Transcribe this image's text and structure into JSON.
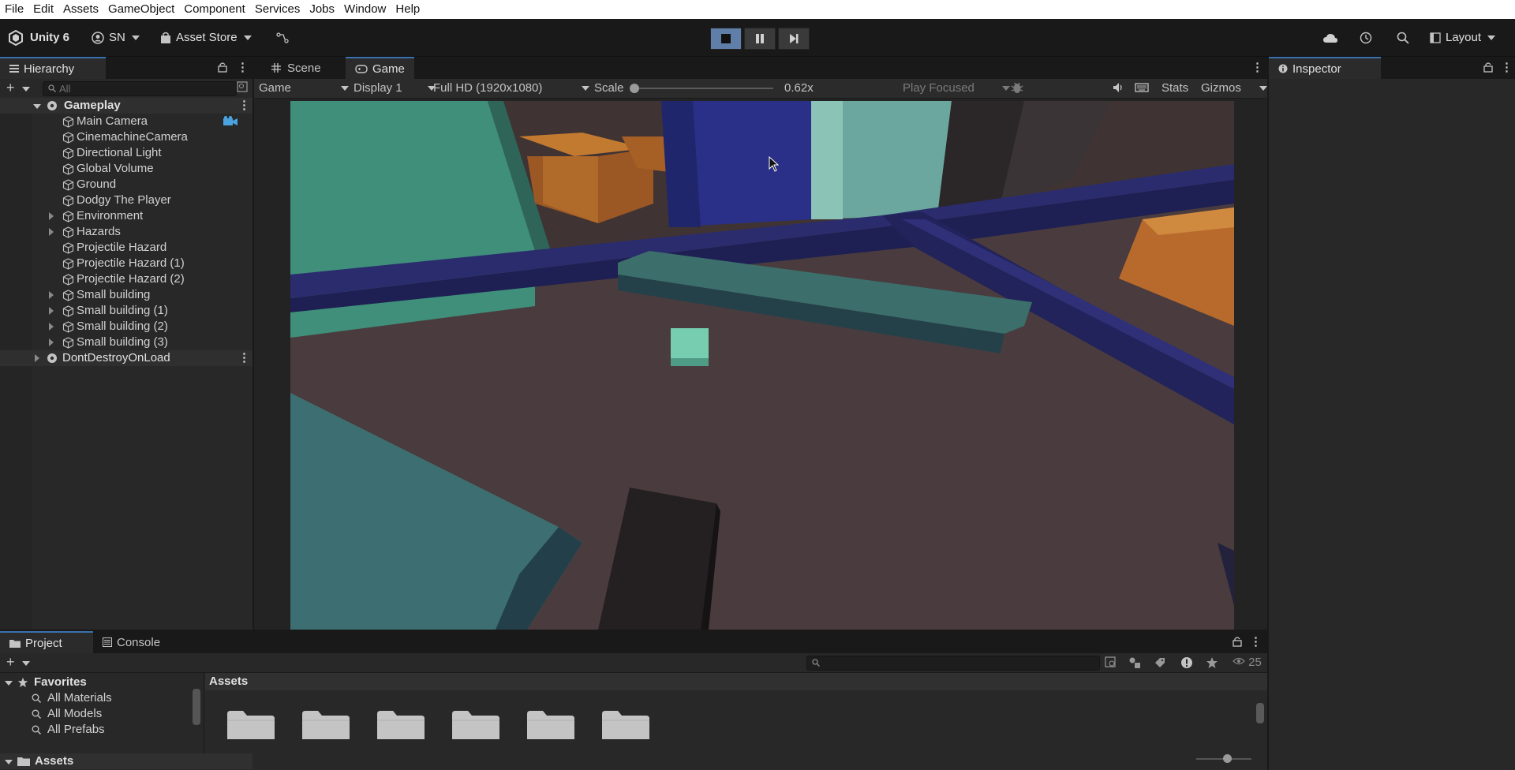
{
  "menu": [
    "File",
    "Edit",
    "Assets",
    "GameObject",
    "Component",
    "Services",
    "Jobs",
    "Window",
    "Help"
  ],
  "toolbar": {
    "app_label": "Unity 6",
    "account_label": "SN",
    "asset_store_label": "Asset Store",
    "layout_label": "Layout"
  },
  "hierarchy": {
    "tab_label": "Hierarchy",
    "search_placeholder": "All",
    "scenes": [
      {
        "name": "Gameplay"
      },
      {
        "name": "DontDestroyOnLoad"
      }
    ],
    "items": [
      {
        "label": "Main Camera"
      },
      {
        "label": "CinemachineCamera"
      },
      {
        "label": "Directional Light"
      },
      {
        "label": "Global Volume"
      },
      {
        "label": "Ground"
      },
      {
        "label": "Dodgy The Player"
      },
      {
        "label": "Environment"
      },
      {
        "label": "Hazards"
      },
      {
        "label": "Projectile Hazard"
      },
      {
        "label": "Projectile Hazard (1)"
      },
      {
        "label": "Projectile Hazard (2)"
      },
      {
        "label": "Small building"
      },
      {
        "label": "Small building (1)"
      },
      {
        "label": "Small building (2)"
      },
      {
        "label": "Small building (3)"
      }
    ]
  },
  "game_view": {
    "tabs": [
      "Scene",
      "Game"
    ],
    "view_select": "Game",
    "display_select": "Display 1",
    "resolution_select": "Full HD (1920x1080)",
    "scale_label": "Scale",
    "scale_value": "0.62x",
    "play_focus": "Play Focused",
    "stats_label": "Stats",
    "gizmos_label": "Gizmos"
  },
  "inspector": {
    "tab_label": "Inspector"
  },
  "project": {
    "tabs": [
      "Project",
      "Console"
    ],
    "favorites_label": "Favorites",
    "favorites": [
      "All Materials",
      "All Models",
      "All Prefabs"
    ],
    "assets_root_label": "Assets",
    "breadcrumb": "Assets",
    "hidden_count": "25",
    "folder_count": 6
  },
  "colors": {
    "accent": "#3a72b0",
    "play_active": "#5f7fa8",
    "ground": "#4a3c3e",
    "navy_wall": "#2b2c6e",
    "teal_block": "#3e6e68",
    "orange_box": "#b86a2c",
    "mint_cube": "#76cdb0"
  }
}
